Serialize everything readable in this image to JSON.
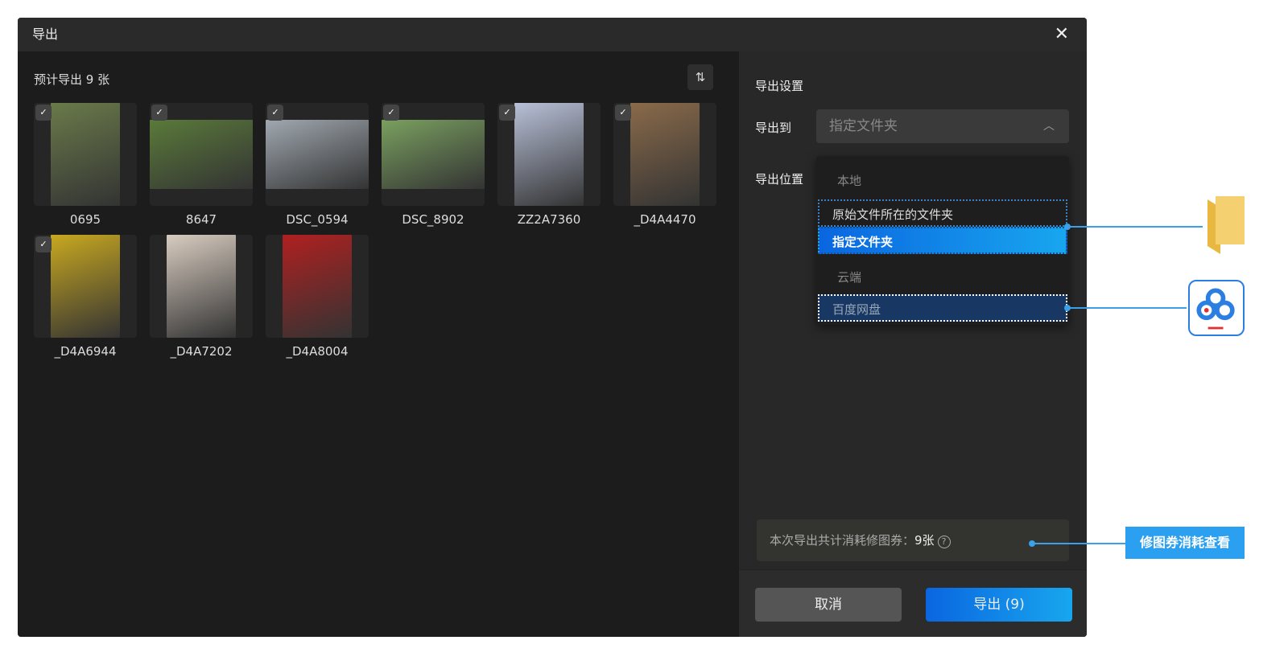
{
  "dialog": {
    "title": "导出",
    "close_icon": "close-icon"
  },
  "left": {
    "count_label": "预计导出 9 张",
    "sort_icon": "sort-icon",
    "photos": [
      {
        "name": "0695",
        "color": "#6a7a4a"
      },
      {
        "name": "8647",
        "color": "#5a7a3a"
      },
      {
        "name": "DSC_0594",
        "color": "#a0a8b0"
      },
      {
        "name": "DSC_8902",
        "color": "#7aa060"
      },
      {
        "name": "ZZ2A7360",
        "color": "#b8c0d8"
      },
      {
        "name": "_D4A4470",
        "color": "#8a6a4a"
      },
      {
        "name": "_D4A6944",
        "color": "#c8a820"
      },
      {
        "name": "_D4A7202",
        "color": "#d8ccc0"
      },
      {
        "name": "_D4A8004",
        "color": "#b02020"
      }
    ]
  },
  "right": {
    "section_title": "导出设置",
    "export_to_label": "导出到",
    "export_to_value": "指定文件夹",
    "location_label": "导出位置",
    "menu": {
      "group_local": "本地",
      "opt_original": "原始文件所在的文件夹",
      "opt_specified": "指定文件夹",
      "group_cloud": "云端",
      "opt_baidu": "百度网盘"
    },
    "info_text": "本次导出共计消耗修图券：",
    "info_count": "9张",
    "info_icon": "?",
    "cancel": "取消",
    "export": "导出 (9)"
  },
  "annotation": {
    "callout": "修图券消耗查看",
    "accent": "#2b9ff0"
  }
}
